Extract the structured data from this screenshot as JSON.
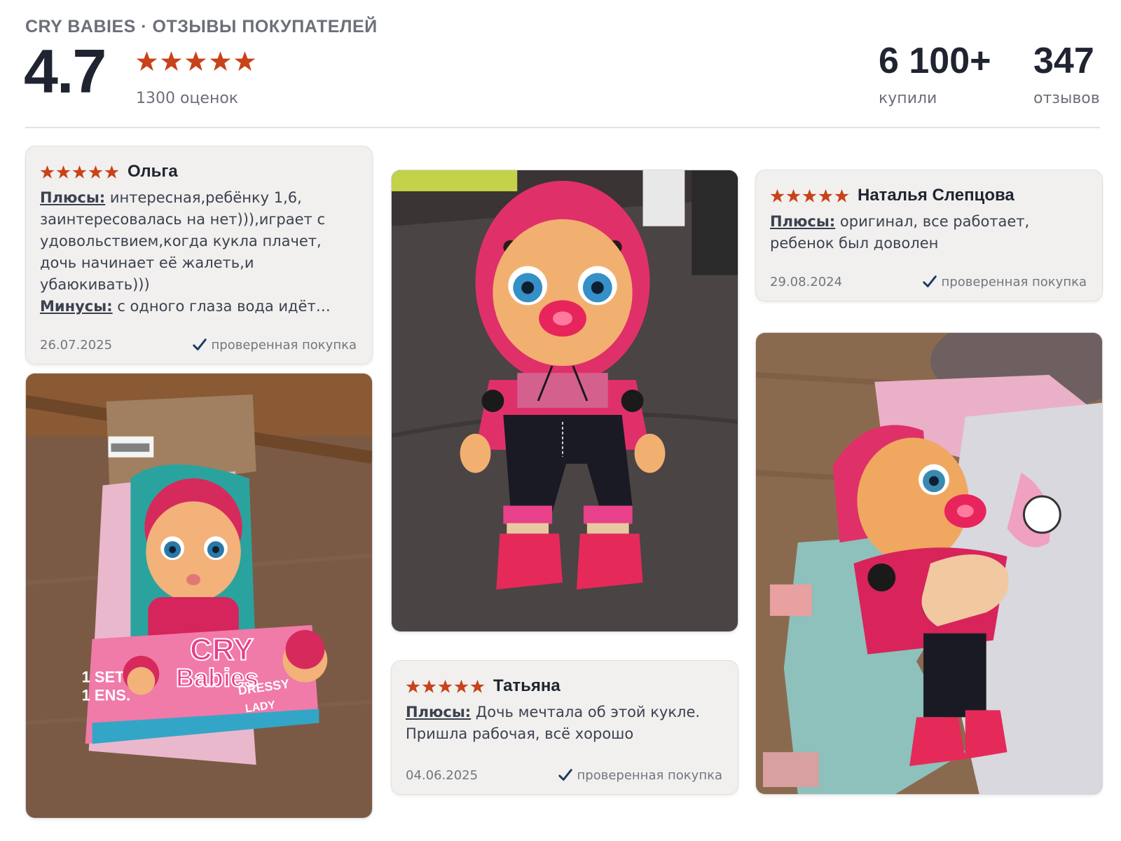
{
  "header": {
    "brand": "CRY BABIES · ОТЗЫВЫ ПОКУПАТЕЛЕЙ",
    "rating": "4.7",
    "rating_count": "1300 оценок",
    "bought_num": "6 100+",
    "bought_label": "купили",
    "reviews_num": "347",
    "reviews_label": "отзывов"
  },
  "colors": {
    "star": "#c8421a",
    "check": "#1f3a64",
    "card_bg": "#f1f0ee"
  },
  "icons": {
    "star": "star-icon",
    "check": "checkmark-icon"
  },
  "reviews": [
    {
      "author": "Ольга",
      "stars": 5,
      "plus_label": "Плюсы:",
      "plus_line1": " интересная,ребёнку 1,6,",
      "plus_line2": "заинтересовалась на нет))),играет с",
      "plus_line3": "удовольствием,когда кукла плачет,",
      "plus_line4": "дочь начинает её жалеть,и",
      "plus_line5": "убаюкивать)))",
      "minus_label": "Минусы:",
      "minus_text": " с одного глаза вода идёт…",
      "date": "26.07.2025",
      "verified": "проверенная покупка"
    },
    {
      "author": "Наталья Слепцова",
      "stars": 5,
      "plus_label": "Плюсы:",
      "plus_line1": " оригинал, все работает,",
      "plus_line2": "ребенок был доволен",
      "date": "29.08.2024",
      "verified": "проверенная покупка"
    },
    {
      "author": "Татьяна",
      "stars": 5,
      "plus_label": "Плюсы:",
      "plus_line1": " Дочь мечтала об этой кукле.",
      "plus_line2": "Пришла рабочая, всё хорошо",
      "date": "04.06.2025",
      "verified": "проверенная покупка"
    }
  ],
  "photos": {
    "box_logo_line1": "CRY",
    "box_logo_line2": "Babies",
    "box_side_text": "DRESSY",
    "box_side_text2": "LADY",
    "box_set_line1": "1 SET",
    "box_set_line2": "1 ENS."
  }
}
